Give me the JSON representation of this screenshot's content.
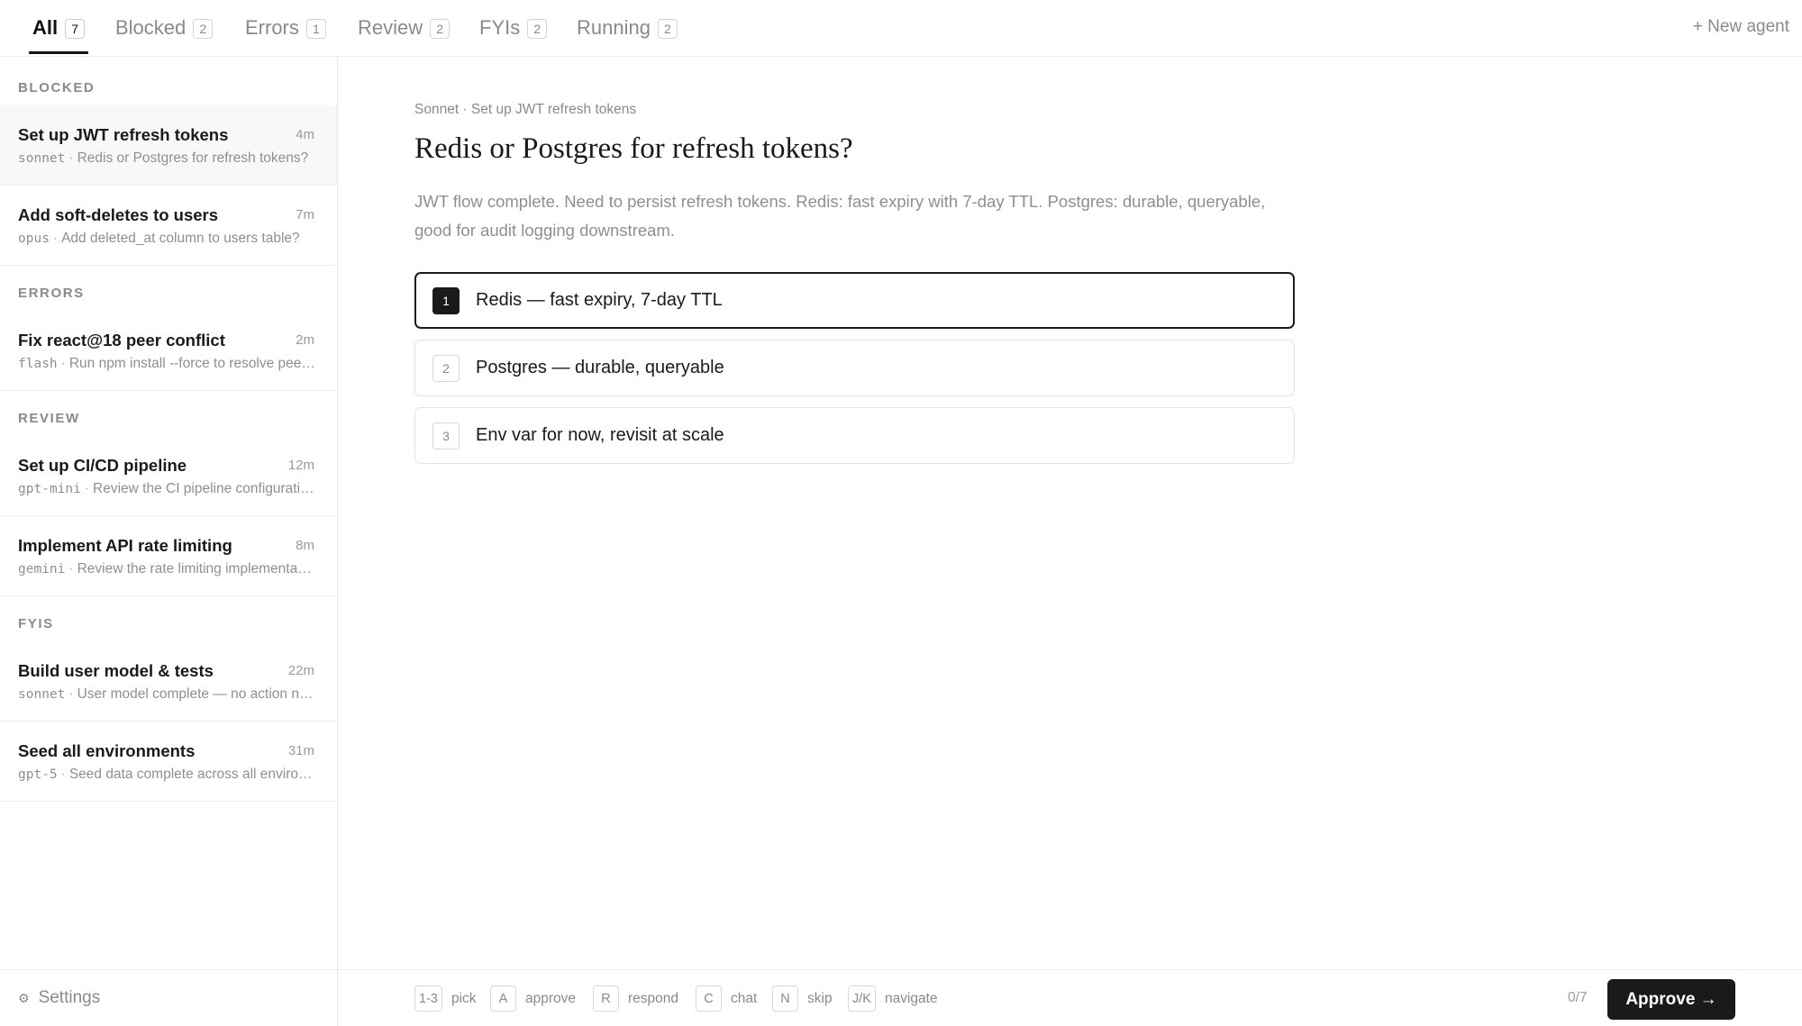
{
  "tabs": [
    {
      "label": "All",
      "count": "7"
    },
    {
      "label": "Blocked",
      "count": "2"
    },
    {
      "label": "Errors",
      "count": "1"
    },
    {
      "label": "Review",
      "count": "2"
    },
    {
      "label": "FYIs",
      "count": "2"
    },
    {
      "label": "Running",
      "count": "2"
    }
  ],
  "new_agent_label": "+ New agent",
  "sidebar": {
    "sections": [
      {
        "heading": "BLOCKED",
        "items": [
          {
            "title": "Set up JWT refresh tokens",
            "time": "4m",
            "model": "sonnet",
            "summary": "Redis or Postgres for refresh tokens?"
          },
          {
            "title": "Add soft-deletes to users",
            "time": "7m",
            "model": "opus",
            "summary": "Add deleted_at column to users table?"
          }
        ]
      },
      {
        "heading": "ERRORS",
        "items": [
          {
            "title": "Fix react@18 peer conflict",
            "time": "2m",
            "model": "flash",
            "summary": "Run npm install --force to resolve peer conflict?"
          }
        ]
      },
      {
        "heading": "REVIEW",
        "items": [
          {
            "title": "Set up CI/CD pipeline",
            "time": "12m",
            "model": "gpt-mini",
            "summary": "Review the CI pipeline configuration"
          },
          {
            "title": "Implement API rate limiting",
            "time": "8m",
            "model": "gemini",
            "summary": "Review the rate limiting implementation"
          }
        ]
      },
      {
        "heading": "FYIS",
        "items": [
          {
            "title": "Build user model & tests",
            "time": "22m",
            "model": "sonnet",
            "summary": "User model complete — no action needed"
          },
          {
            "title": "Seed all environments",
            "time": "31m",
            "model": "gpt-5",
            "summary": "Seed data complete across all environments"
          }
        ]
      }
    ],
    "settings_label": "Settings"
  },
  "main": {
    "breadcrumb": "Sonnet · Set up JWT refresh tokens",
    "question": "Redis or Postgres for refresh tokens?",
    "context": "JWT flow complete. Need to persist refresh tokens. Redis: fast expiry with 7-day TTL. Postgres: durable, queryable, good for audit logging downstream.",
    "options": [
      {
        "key": "1",
        "label": "Redis — fast expiry, 7-day TTL"
      },
      {
        "key": "2",
        "label": "Postgres — durable, queryable"
      },
      {
        "key": "3",
        "label": "Env var for now, revisit at scale"
      }
    ]
  },
  "bottombar": {
    "hints": [
      {
        "key": "1-3",
        "label": "pick"
      },
      {
        "key": "A",
        "label": "approve"
      },
      {
        "key": "R",
        "label": "respond"
      },
      {
        "key": "C",
        "label": "chat"
      },
      {
        "key": "N",
        "label": "skip"
      },
      {
        "key": "J/K",
        "label": "navigate"
      }
    ],
    "progress": "0/7",
    "approve_label": "Approve →"
  }
}
